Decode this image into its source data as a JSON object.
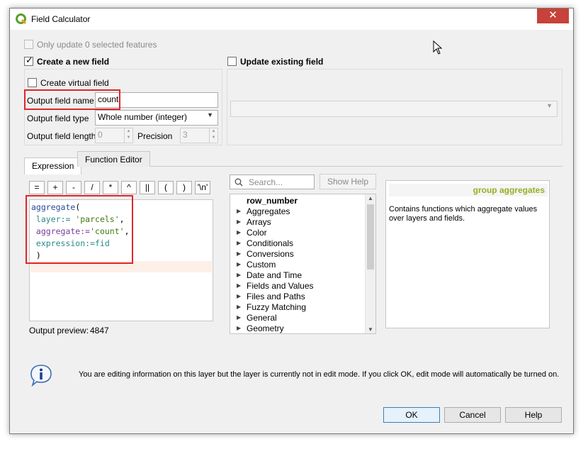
{
  "window": {
    "title": "Field Calculator",
    "close_label": "✕"
  },
  "top": {
    "only_update_label": "Only update 0 selected features"
  },
  "create_new": {
    "label": "Create a new field",
    "virtual_label": "Create virtual field",
    "name_label": "Output field name",
    "name_value": "count",
    "type_label": "Output field type",
    "type_value": "Whole number (integer)",
    "length_label": "Output field length",
    "length_value": "0",
    "precision_label": "Precision",
    "precision_value": "3"
  },
  "update_existing": {
    "label": "Update existing field",
    "select_value": ""
  },
  "tabs": [
    {
      "label": "Expression"
    },
    {
      "label": "Function Editor"
    }
  ],
  "operators": [
    "=",
    "+",
    "-",
    "/",
    "*",
    "^",
    "||",
    "(",
    ")",
    "'\\n'"
  ],
  "expression": {
    "lines": [
      {
        "parts": [
          [
            "kw",
            "aggregate"
          ],
          [
            "plain",
            "("
          ]
        ]
      },
      {
        "parts": [
          [
            "param",
            " layer:="
          ],
          [
            "plain",
            " "
          ],
          [
            "str",
            "'parcels'"
          ],
          [
            "plain",
            ","
          ]
        ]
      },
      {
        "parts": [
          [
            "ptag",
            " aggregate:="
          ],
          [
            "str",
            "'count'"
          ],
          [
            "plain",
            ","
          ]
        ]
      },
      {
        "parts": [
          [
            "param",
            " expression:=fid"
          ]
        ]
      },
      {
        "parts": [
          [
            "plain",
            " )"
          ]
        ]
      }
    ]
  },
  "preview": {
    "label": "Output preview:",
    "value": "4847"
  },
  "search": {
    "placeholder": "Search...",
    "show_help_label": "Show Help"
  },
  "tree": {
    "items": [
      {
        "label": "row_number",
        "expandable": false,
        "bold": true
      },
      {
        "label": "Aggregates",
        "expandable": true
      },
      {
        "label": "Arrays",
        "expandable": true
      },
      {
        "label": "Color",
        "expandable": true
      },
      {
        "label": "Conditionals",
        "expandable": true
      },
      {
        "label": "Conversions",
        "expandable": true
      },
      {
        "label": "Custom",
        "expandable": true
      },
      {
        "label": "Date and Time",
        "expandable": true
      },
      {
        "label": "Fields and Values",
        "expandable": true
      },
      {
        "label": "Files and Paths",
        "expandable": true
      },
      {
        "label": "Fuzzy Matching",
        "expandable": true
      },
      {
        "label": "General",
        "expandable": true
      },
      {
        "label": "Geometry",
        "expandable": true
      }
    ]
  },
  "help": {
    "title": "group aggregates",
    "body": "Contains functions which aggregate values over layers and fields.",
    "title_color": "#93b023"
  },
  "info": {
    "message": "You are editing information on this layer but the layer is currently not in edit mode. If you click OK, edit mode will automatically be turned on."
  },
  "buttons": {
    "ok": "OK",
    "cancel": "Cancel",
    "help": "Help"
  },
  "icons": {
    "app": "qgis-icon",
    "info": "info-icon",
    "search": "search-icon"
  }
}
